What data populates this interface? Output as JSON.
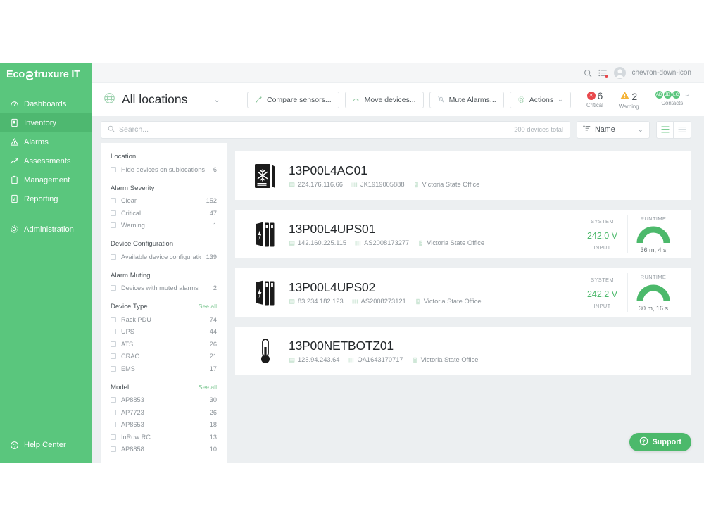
{
  "app": {
    "logo_eco": "Eco",
    "logo_struxure": "truxure IT"
  },
  "topbar": {
    "search_icon": "search-icon",
    "notifications_icon": "notifications-list-icon",
    "account_icon": "user-avatar-icon",
    "chevron_icon": "chevron-down-icon"
  },
  "sidebar": {
    "items": [
      {
        "label": "Dashboards",
        "icon": "dashboards-icon",
        "active": false
      },
      {
        "label": "Inventory",
        "icon": "inventory-icon",
        "active": true
      },
      {
        "label": "Alarms",
        "icon": "alarms-warning-icon",
        "active": false
      },
      {
        "label": "Assessments",
        "icon": "assessments-chart-icon",
        "active": false
      },
      {
        "label": "Management",
        "icon": "management-clipboard-icon",
        "active": false
      },
      {
        "label": "Reporting",
        "icon": "reporting-document-icon",
        "active": false
      },
      {
        "label": "Administration",
        "icon": "gear-icon",
        "active": false
      }
    ],
    "help_center": "Help Center",
    "help_icon": "question-circle-icon"
  },
  "header": {
    "location_title": "All locations",
    "location_icon": "globe-icon",
    "location_chevron": "⌄",
    "buttons": [
      {
        "label": "Compare sensors...",
        "icon": "compare-sensors-icon"
      },
      {
        "label": "Move devices...",
        "icon": "move-devices-icon"
      },
      {
        "label": "Mute Alarms...",
        "icon": "mute-alarms-bell-icon"
      },
      {
        "label": "Actions",
        "icon": "gear-icon",
        "chevron": "⌄"
      }
    ],
    "status": {
      "critical_count": "6",
      "critical_label": "Critical",
      "warning_count": "2",
      "warning_label": "Warning",
      "contacts_label": "Contacts",
      "contacts": [
        "AD",
        "JB",
        "LC"
      ],
      "contacts_chevron": "⌄"
    },
    "colors": {
      "critical": "#e8474b",
      "warning": "#f5b335",
      "brand_green": "#5ac67d",
      "value_green": "#4cb96b"
    }
  },
  "search": {
    "placeholder": "Search...",
    "value": "",
    "search_icon": "search-icon",
    "devices_total": "200 devices total",
    "sort_label": "Name",
    "sort_icon": "sort-ascending-icon",
    "sort_chevron": "⌄",
    "view_list_icon": "list-view-icon",
    "view_compact_icon": "compact-view-icon"
  },
  "filters": [
    {
      "title": "Location",
      "see_all": "",
      "rows": [
        {
          "label": "Hide devices on sublocations",
          "count": "6"
        }
      ]
    },
    {
      "title": "Alarm Severity",
      "see_all": "",
      "rows": [
        {
          "label": "Clear",
          "count": "152"
        },
        {
          "label": "Critical",
          "count": "47"
        },
        {
          "label": "Warning",
          "count": "1"
        }
      ]
    },
    {
      "title": "Device Configuration",
      "see_all": "",
      "rows": [
        {
          "label": "Available device configurations",
          "count": "139"
        }
      ]
    },
    {
      "title": "Alarm Muting",
      "see_all": "",
      "rows": [
        {
          "label": "Devices with muted alarms",
          "count": "2"
        }
      ]
    },
    {
      "title": "Device Type",
      "see_all": "See all",
      "rows": [
        {
          "label": "Rack PDU",
          "count": "74"
        },
        {
          "label": "UPS",
          "count": "44"
        },
        {
          "label": "ATS",
          "count": "26"
        },
        {
          "label": "CRAC",
          "count": "21"
        },
        {
          "label": "EMS",
          "count": "17"
        }
      ]
    },
    {
      "title": "Model",
      "see_all": "See all",
      "rows": [
        {
          "label": "AP8853",
          "count": "30"
        },
        {
          "label": "AP7723",
          "count": "26"
        },
        {
          "label": "AP8653",
          "count": "18"
        },
        {
          "label": "InRow RC",
          "count": "13"
        },
        {
          "label": "AP8858",
          "count": "10"
        }
      ]
    }
  ],
  "devices": [
    {
      "name": "13P00L4AC01",
      "device_icon": "cooling-unit-icon",
      "ip": "224.176.116.66",
      "serial": "JK1919005888",
      "location": "Victoria State Office",
      "metrics": []
    },
    {
      "name": "13P00L4UPS01",
      "device_icon": "ups-icon",
      "ip": "142.160.225.115",
      "serial": "AS2008173277",
      "location": "Victoria State Office",
      "metrics": [
        {
          "kind": "value",
          "title": "SYSTEM",
          "value": "242.0 V",
          "sub": "INPUT"
        },
        {
          "kind": "gauge",
          "title": "RUNTIME",
          "value": "36 m, 4 s",
          "percent": 100
        }
      ]
    },
    {
      "name": "13P00L4UPS02",
      "device_icon": "ups-icon",
      "ip": "83.234.182.123",
      "serial": "AS2008273121",
      "location": "Victoria State Office",
      "metrics": [
        {
          "kind": "value",
          "title": "SYSTEM",
          "value": "242.2 V",
          "sub": "INPUT"
        },
        {
          "kind": "gauge",
          "title": "RUNTIME",
          "value": "30 m, 16 s",
          "percent": 100
        }
      ]
    },
    {
      "name": "13P00NETBOTZ01",
      "device_icon": "thermometer-icon",
      "ip": "125.94.243.64",
      "serial": "QA1643170717",
      "location": "Victoria State Office",
      "metrics": []
    }
  ],
  "support": {
    "label": "Support",
    "icon": "question-circle-icon"
  },
  "meta_icons": {
    "ip": "network-ip-icon",
    "serial": "barcode-serial-icon",
    "location": "location-building-icon"
  }
}
